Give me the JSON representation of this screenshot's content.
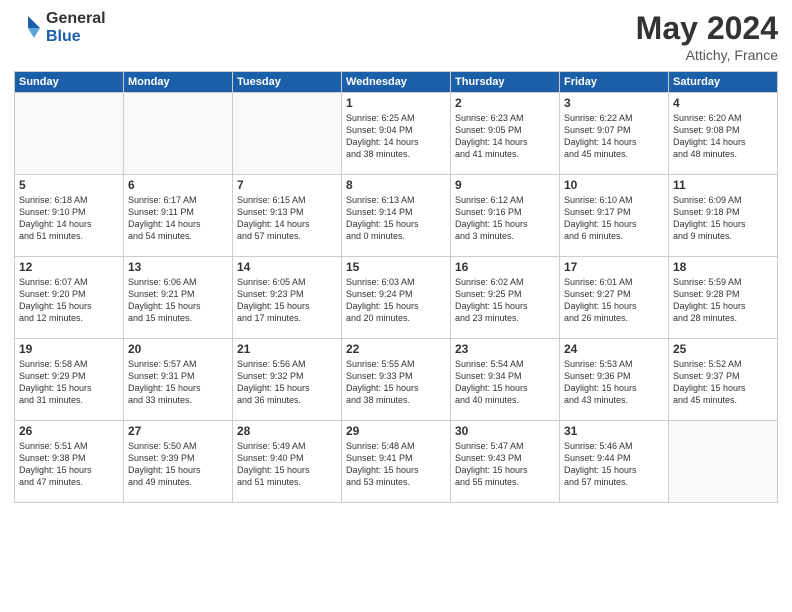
{
  "logo": {
    "general": "General",
    "blue": "Blue"
  },
  "title": {
    "month_year": "May 2024",
    "location": "Attichy, France"
  },
  "weekdays": [
    "Sunday",
    "Monday",
    "Tuesday",
    "Wednesday",
    "Thursday",
    "Friday",
    "Saturday"
  ],
  "weeks": [
    [
      {
        "day": "",
        "info": ""
      },
      {
        "day": "",
        "info": ""
      },
      {
        "day": "",
        "info": ""
      },
      {
        "day": "1",
        "info": "Sunrise: 6:25 AM\nSunset: 9:04 PM\nDaylight: 14 hours\nand 38 minutes."
      },
      {
        "day": "2",
        "info": "Sunrise: 6:23 AM\nSunset: 9:05 PM\nDaylight: 14 hours\nand 41 minutes."
      },
      {
        "day": "3",
        "info": "Sunrise: 6:22 AM\nSunset: 9:07 PM\nDaylight: 14 hours\nand 45 minutes."
      },
      {
        "day": "4",
        "info": "Sunrise: 6:20 AM\nSunset: 9:08 PM\nDaylight: 14 hours\nand 48 minutes."
      }
    ],
    [
      {
        "day": "5",
        "info": "Sunrise: 6:18 AM\nSunset: 9:10 PM\nDaylight: 14 hours\nand 51 minutes."
      },
      {
        "day": "6",
        "info": "Sunrise: 6:17 AM\nSunset: 9:11 PM\nDaylight: 14 hours\nand 54 minutes."
      },
      {
        "day": "7",
        "info": "Sunrise: 6:15 AM\nSunset: 9:13 PM\nDaylight: 14 hours\nand 57 minutes."
      },
      {
        "day": "8",
        "info": "Sunrise: 6:13 AM\nSunset: 9:14 PM\nDaylight: 15 hours\nand 0 minutes."
      },
      {
        "day": "9",
        "info": "Sunrise: 6:12 AM\nSunset: 9:16 PM\nDaylight: 15 hours\nand 3 minutes."
      },
      {
        "day": "10",
        "info": "Sunrise: 6:10 AM\nSunset: 9:17 PM\nDaylight: 15 hours\nand 6 minutes."
      },
      {
        "day": "11",
        "info": "Sunrise: 6:09 AM\nSunset: 9:18 PM\nDaylight: 15 hours\nand 9 minutes."
      }
    ],
    [
      {
        "day": "12",
        "info": "Sunrise: 6:07 AM\nSunset: 9:20 PM\nDaylight: 15 hours\nand 12 minutes."
      },
      {
        "day": "13",
        "info": "Sunrise: 6:06 AM\nSunset: 9:21 PM\nDaylight: 15 hours\nand 15 minutes."
      },
      {
        "day": "14",
        "info": "Sunrise: 6:05 AM\nSunset: 9:23 PM\nDaylight: 15 hours\nand 17 minutes."
      },
      {
        "day": "15",
        "info": "Sunrise: 6:03 AM\nSunset: 9:24 PM\nDaylight: 15 hours\nand 20 minutes."
      },
      {
        "day": "16",
        "info": "Sunrise: 6:02 AM\nSunset: 9:25 PM\nDaylight: 15 hours\nand 23 minutes."
      },
      {
        "day": "17",
        "info": "Sunrise: 6:01 AM\nSunset: 9:27 PM\nDaylight: 15 hours\nand 26 minutes."
      },
      {
        "day": "18",
        "info": "Sunrise: 5:59 AM\nSunset: 9:28 PM\nDaylight: 15 hours\nand 28 minutes."
      }
    ],
    [
      {
        "day": "19",
        "info": "Sunrise: 5:58 AM\nSunset: 9:29 PM\nDaylight: 15 hours\nand 31 minutes."
      },
      {
        "day": "20",
        "info": "Sunrise: 5:57 AM\nSunset: 9:31 PM\nDaylight: 15 hours\nand 33 minutes."
      },
      {
        "day": "21",
        "info": "Sunrise: 5:56 AM\nSunset: 9:32 PM\nDaylight: 15 hours\nand 36 minutes."
      },
      {
        "day": "22",
        "info": "Sunrise: 5:55 AM\nSunset: 9:33 PM\nDaylight: 15 hours\nand 38 minutes."
      },
      {
        "day": "23",
        "info": "Sunrise: 5:54 AM\nSunset: 9:34 PM\nDaylight: 15 hours\nand 40 minutes."
      },
      {
        "day": "24",
        "info": "Sunrise: 5:53 AM\nSunset: 9:36 PM\nDaylight: 15 hours\nand 43 minutes."
      },
      {
        "day": "25",
        "info": "Sunrise: 5:52 AM\nSunset: 9:37 PM\nDaylight: 15 hours\nand 45 minutes."
      }
    ],
    [
      {
        "day": "26",
        "info": "Sunrise: 5:51 AM\nSunset: 9:38 PM\nDaylight: 15 hours\nand 47 minutes."
      },
      {
        "day": "27",
        "info": "Sunrise: 5:50 AM\nSunset: 9:39 PM\nDaylight: 15 hours\nand 49 minutes."
      },
      {
        "day": "28",
        "info": "Sunrise: 5:49 AM\nSunset: 9:40 PM\nDaylight: 15 hours\nand 51 minutes."
      },
      {
        "day": "29",
        "info": "Sunrise: 5:48 AM\nSunset: 9:41 PM\nDaylight: 15 hours\nand 53 minutes."
      },
      {
        "day": "30",
        "info": "Sunrise: 5:47 AM\nSunset: 9:43 PM\nDaylight: 15 hours\nand 55 minutes."
      },
      {
        "day": "31",
        "info": "Sunrise: 5:46 AM\nSunset: 9:44 PM\nDaylight: 15 hours\nand 57 minutes."
      },
      {
        "day": "",
        "info": ""
      }
    ]
  ]
}
